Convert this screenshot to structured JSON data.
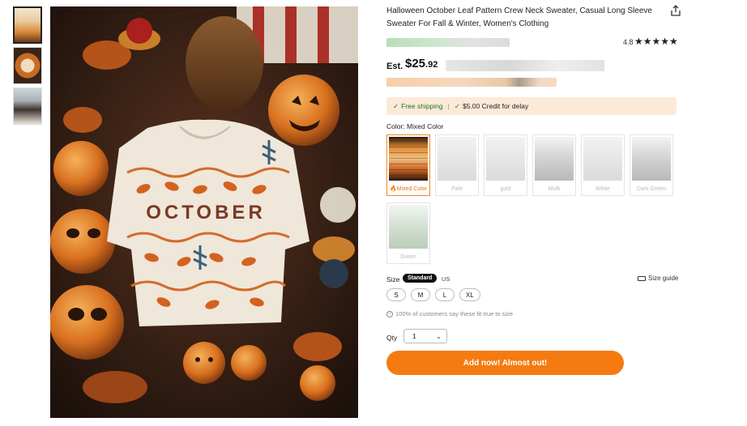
{
  "gallery": {
    "thumbnails": [
      "thumbnail-1",
      "thumbnail-2",
      "thumbnail-3"
    ],
    "active_index": 0,
    "main_image": {
      "sweater_text": "OCTOBER"
    }
  },
  "product": {
    "title": "Halloween October Leaf Pattern Crew Neck Sweater, Casual Long Sleeve Sweater For Fall & Winter, Women's Clothing",
    "share_icon": "share-icon",
    "rating": "4.8",
    "stars": "★★★★★",
    "price": {
      "prefix": "Est.",
      "currency": "$",
      "whole": "25",
      "cents": ".92"
    }
  },
  "shipping": {
    "free_shipping": "Free shipping",
    "separator": "|",
    "credit": "$5.00 Credit for delay"
  },
  "color": {
    "label": "Color: Mixed Color",
    "options": [
      {
        "label": "Mixed Color",
        "selected": true
      },
      {
        "label": "Pale",
        "selected": false
      },
      {
        "label": "gold",
        "selected": false
      },
      {
        "label": "Multi",
        "selected": false
      },
      {
        "label": "White",
        "selected": false
      },
      {
        "label": "Dark Green",
        "selected": false
      },
      {
        "label": "Green",
        "selected": false
      }
    ]
  },
  "size": {
    "label": "Size",
    "standard": "Standard",
    "us": "US",
    "guide": "Size guide",
    "options": [
      "S",
      "M",
      "L",
      "XL"
    ],
    "fit_note": "100% of customers say these fit true to size"
  },
  "quantity": {
    "label": "Qty",
    "value": "1"
  },
  "cta": {
    "label": "Add now! Almost out!"
  },
  "colors": {
    "accent": "#f57b10",
    "shipping_bg": "#fde9d7",
    "success": "#1a8a2e"
  }
}
